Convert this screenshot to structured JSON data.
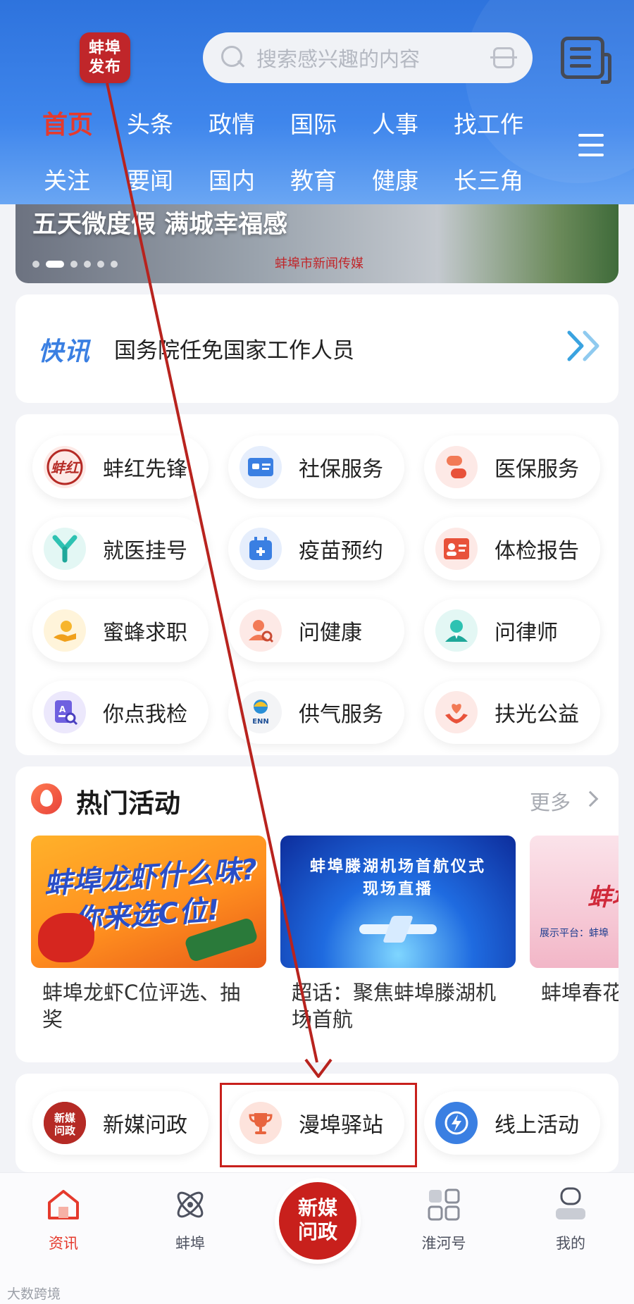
{
  "header": {
    "logo_line1": "蚌埠",
    "logo_line2": "发布",
    "search_placeholder": "搜索感兴趣的内容",
    "tabs_row1": [
      "首页",
      "头条",
      "政情",
      "国际",
      "人事",
      "找工作"
    ],
    "tabs_row2": [
      "关注",
      "要闻",
      "国内",
      "教育",
      "健康",
      "长三角"
    ],
    "active_tab": "首页"
  },
  "banner": {
    "title": "五天微度假  满城幸福感",
    "watermark": "蚌埠市新闻传媒"
  },
  "kuaixun": {
    "label": "快讯",
    "text": "国务院任免国家工作人员"
  },
  "services": [
    {
      "label": "蚌红先锋",
      "icon": "bohong-icon",
      "color": "#fde9e6"
    },
    {
      "label": "社保服务",
      "icon": "social-security-card-icon",
      "color": "#e6eefc"
    },
    {
      "label": "医保服务",
      "icon": "medical-pill-icon",
      "color": "#fde9e6"
    },
    {
      "label": "就医挂号",
      "icon": "hospital-y-icon",
      "color": "#e3f7f4"
    },
    {
      "label": "疫苗预约",
      "icon": "calendar-plus-icon",
      "color": "#e6eefc"
    },
    {
      "label": "体检报告",
      "icon": "id-card-icon",
      "color": "#fde9e6"
    },
    {
      "label": "蜜蜂求职",
      "icon": "job-hand-icon",
      "color": "#fff4da"
    },
    {
      "label": "问健康",
      "icon": "health-user-icon",
      "color": "#fde9e6"
    },
    {
      "label": "问律师",
      "icon": "lawyer-icon",
      "color": "#e3f7f4"
    },
    {
      "label": "你点我检",
      "icon": "document-search-icon",
      "color": "#ece8fc"
    },
    {
      "label": "供气服务",
      "icon": "enn-gas-icon",
      "color": "#f3f4f6"
    },
    {
      "label": "扶光公益",
      "icon": "charity-heart-icon",
      "color": "#fde9e6"
    }
  ],
  "hot": {
    "title": "热门活动",
    "more": "更多",
    "items": [
      {
        "caption": "蚌埠龙虾C位评选、抽奖",
        "img_line1": "蚌埠龙虾什么味?",
        "img_line2": "你来选C位!"
      },
      {
        "caption": "超话：聚焦蚌埠滕湖机场首航",
        "img_line1": "蚌埠滕湖机场首航仪式",
        "img_line2": "现场直播"
      },
      {
        "caption": "蚌埠春花(高校版)",
        "img_line1": "蚌埠",
        "img_line2": "展示平台：蚌埠"
      }
    ]
  },
  "bottom_services": [
    {
      "label": "新媒问政",
      "icon": "xinmei-wenzheng-icon"
    },
    {
      "label": "漫埠驿站",
      "icon": "trophy-icon"
    },
    {
      "label": "线上活动",
      "icon": "lightning-icon"
    }
  ],
  "bottom_nav": {
    "items": [
      {
        "label": "资讯",
        "icon": "home-icon"
      },
      {
        "label": "蚌埠",
        "icon": "atom-icon"
      },
      {
        "label": "淮河号",
        "icon": "grid-apps-icon"
      },
      {
        "label": "我的",
        "icon": "profile-icon"
      }
    ],
    "center_line1": "新媒",
    "center_line2": "问政"
  },
  "brand_watermark": "大数跨境",
  "colors": {
    "accent_red": "#c8201c",
    "active_tab": "#e53a2d",
    "header_blue": "#3f86ec",
    "kuaixun_blue": "#3a7fe2"
  }
}
